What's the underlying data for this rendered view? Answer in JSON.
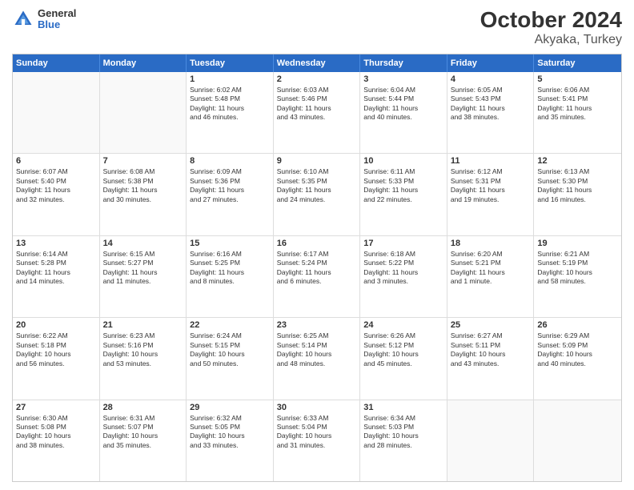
{
  "header": {
    "logo_general": "General",
    "logo_blue": "Blue",
    "title": "October 2024",
    "subtitle": "Akyaka, Turkey"
  },
  "weekdays": [
    "Sunday",
    "Monday",
    "Tuesday",
    "Wednesday",
    "Thursday",
    "Friday",
    "Saturday"
  ],
  "weeks": [
    [
      {
        "day": "",
        "lines": []
      },
      {
        "day": "",
        "lines": []
      },
      {
        "day": "1",
        "lines": [
          "Sunrise: 6:02 AM",
          "Sunset: 5:48 PM",
          "Daylight: 11 hours",
          "and 46 minutes."
        ]
      },
      {
        "day": "2",
        "lines": [
          "Sunrise: 6:03 AM",
          "Sunset: 5:46 PM",
          "Daylight: 11 hours",
          "and 43 minutes."
        ]
      },
      {
        "day": "3",
        "lines": [
          "Sunrise: 6:04 AM",
          "Sunset: 5:44 PM",
          "Daylight: 11 hours",
          "and 40 minutes."
        ]
      },
      {
        "day": "4",
        "lines": [
          "Sunrise: 6:05 AM",
          "Sunset: 5:43 PM",
          "Daylight: 11 hours",
          "and 38 minutes."
        ]
      },
      {
        "day": "5",
        "lines": [
          "Sunrise: 6:06 AM",
          "Sunset: 5:41 PM",
          "Daylight: 11 hours",
          "and 35 minutes."
        ]
      }
    ],
    [
      {
        "day": "6",
        "lines": [
          "Sunrise: 6:07 AM",
          "Sunset: 5:40 PM",
          "Daylight: 11 hours",
          "and 32 minutes."
        ]
      },
      {
        "day": "7",
        "lines": [
          "Sunrise: 6:08 AM",
          "Sunset: 5:38 PM",
          "Daylight: 11 hours",
          "and 30 minutes."
        ]
      },
      {
        "day": "8",
        "lines": [
          "Sunrise: 6:09 AM",
          "Sunset: 5:36 PM",
          "Daylight: 11 hours",
          "and 27 minutes."
        ]
      },
      {
        "day": "9",
        "lines": [
          "Sunrise: 6:10 AM",
          "Sunset: 5:35 PM",
          "Daylight: 11 hours",
          "and 24 minutes."
        ]
      },
      {
        "day": "10",
        "lines": [
          "Sunrise: 6:11 AM",
          "Sunset: 5:33 PM",
          "Daylight: 11 hours",
          "and 22 minutes."
        ]
      },
      {
        "day": "11",
        "lines": [
          "Sunrise: 6:12 AM",
          "Sunset: 5:31 PM",
          "Daylight: 11 hours",
          "and 19 minutes."
        ]
      },
      {
        "day": "12",
        "lines": [
          "Sunrise: 6:13 AM",
          "Sunset: 5:30 PM",
          "Daylight: 11 hours",
          "and 16 minutes."
        ]
      }
    ],
    [
      {
        "day": "13",
        "lines": [
          "Sunrise: 6:14 AM",
          "Sunset: 5:28 PM",
          "Daylight: 11 hours",
          "and 14 minutes."
        ]
      },
      {
        "day": "14",
        "lines": [
          "Sunrise: 6:15 AM",
          "Sunset: 5:27 PM",
          "Daylight: 11 hours",
          "and 11 minutes."
        ]
      },
      {
        "day": "15",
        "lines": [
          "Sunrise: 6:16 AM",
          "Sunset: 5:25 PM",
          "Daylight: 11 hours",
          "and 8 minutes."
        ]
      },
      {
        "day": "16",
        "lines": [
          "Sunrise: 6:17 AM",
          "Sunset: 5:24 PM",
          "Daylight: 11 hours",
          "and 6 minutes."
        ]
      },
      {
        "day": "17",
        "lines": [
          "Sunrise: 6:18 AM",
          "Sunset: 5:22 PM",
          "Daylight: 11 hours",
          "and 3 minutes."
        ]
      },
      {
        "day": "18",
        "lines": [
          "Sunrise: 6:20 AM",
          "Sunset: 5:21 PM",
          "Daylight: 11 hours",
          "and 1 minute."
        ]
      },
      {
        "day": "19",
        "lines": [
          "Sunrise: 6:21 AM",
          "Sunset: 5:19 PM",
          "Daylight: 10 hours",
          "and 58 minutes."
        ]
      }
    ],
    [
      {
        "day": "20",
        "lines": [
          "Sunrise: 6:22 AM",
          "Sunset: 5:18 PM",
          "Daylight: 10 hours",
          "and 56 minutes."
        ]
      },
      {
        "day": "21",
        "lines": [
          "Sunrise: 6:23 AM",
          "Sunset: 5:16 PM",
          "Daylight: 10 hours",
          "and 53 minutes."
        ]
      },
      {
        "day": "22",
        "lines": [
          "Sunrise: 6:24 AM",
          "Sunset: 5:15 PM",
          "Daylight: 10 hours",
          "and 50 minutes."
        ]
      },
      {
        "day": "23",
        "lines": [
          "Sunrise: 6:25 AM",
          "Sunset: 5:14 PM",
          "Daylight: 10 hours",
          "and 48 minutes."
        ]
      },
      {
        "day": "24",
        "lines": [
          "Sunrise: 6:26 AM",
          "Sunset: 5:12 PM",
          "Daylight: 10 hours",
          "and 45 minutes."
        ]
      },
      {
        "day": "25",
        "lines": [
          "Sunrise: 6:27 AM",
          "Sunset: 5:11 PM",
          "Daylight: 10 hours",
          "and 43 minutes."
        ]
      },
      {
        "day": "26",
        "lines": [
          "Sunrise: 6:29 AM",
          "Sunset: 5:09 PM",
          "Daylight: 10 hours",
          "and 40 minutes."
        ]
      }
    ],
    [
      {
        "day": "27",
        "lines": [
          "Sunrise: 6:30 AM",
          "Sunset: 5:08 PM",
          "Daylight: 10 hours",
          "and 38 minutes."
        ]
      },
      {
        "day": "28",
        "lines": [
          "Sunrise: 6:31 AM",
          "Sunset: 5:07 PM",
          "Daylight: 10 hours",
          "and 35 minutes."
        ]
      },
      {
        "day": "29",
        "lines": [
          "Sunrise: 6:32 AM",
          "Sunset: 5:05 PM",
          "Daylight: 10 hours",
          "and 33 minutes."
        ]
      },
      {
        "day": "30",
        "lines": [
          "Sunrise: 6:33 AM",
          "Sunset: 5:04 PM",
          "Daylight: 10 hours",
          "and 31 minutes."
        ]
      },
      {
        "day": "31",
        "lines": [
          "Sunrise: 6:34 AM",
          "Sunset: 5:03 PM",
          "Daylight: 10 hours",
          "and 28 minutes."
        ]
      },
      {
        "day": "",
        "lines": []
      },
      {
        "day": "",
        "lines": []
      }
    ]
  ]
}
